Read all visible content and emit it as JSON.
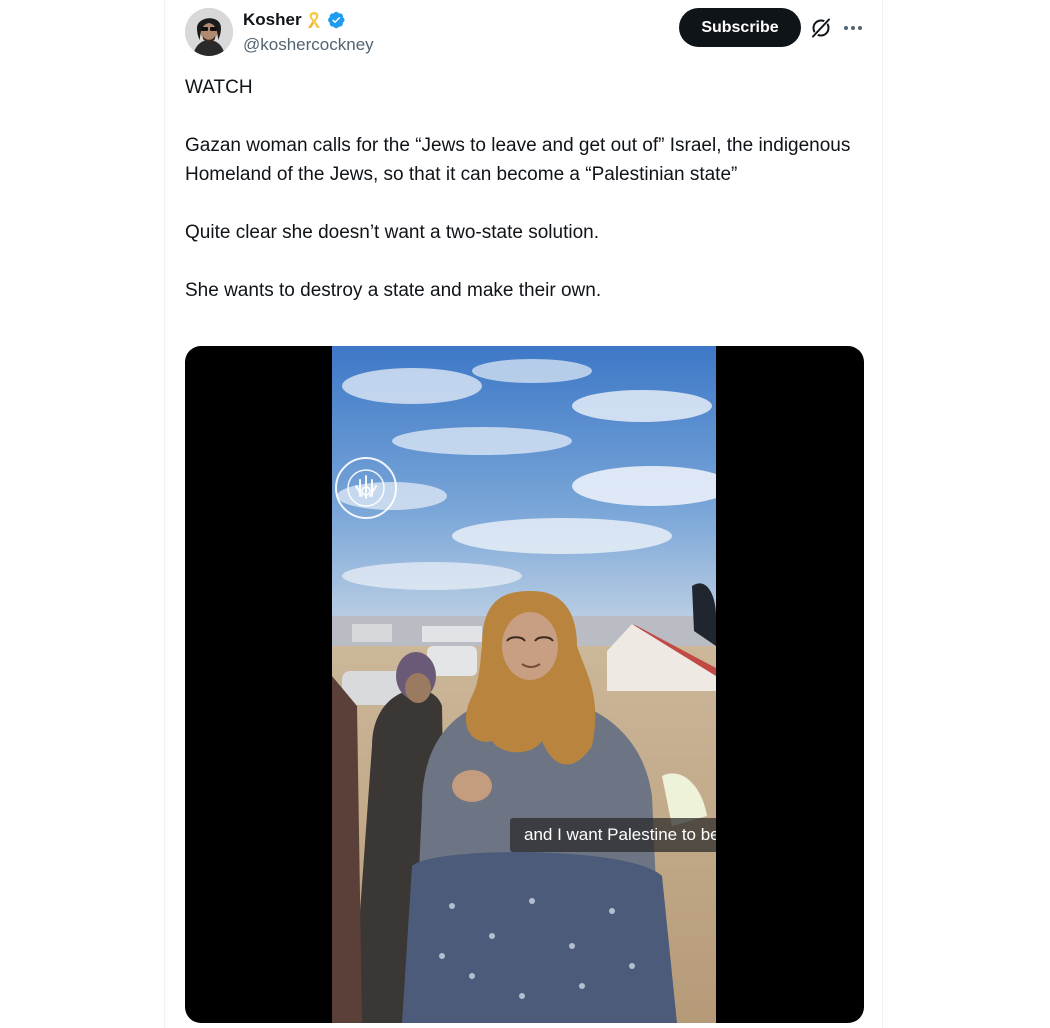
{
  "author": {
    "display_name": "Kosher",
    "handle": "@koshercockney",
    "ribbon_icon": "yellow-ribbon-icon",
    "verified_icon": "verified-badge-icon"
  },
  "header": {
    "subscribe_label": "Subscribe",
    "grok_icon": "grok-icon",
    "more_icon": "more-options-icon"
  },
  "tweet": {
    "paragraphs": [
      "WATCH",
      "Gazan woman calls for the “Jews to leave and get out of” Israel, the indigenous Homeland of the Jews, so that it can become a “Palestinian state”",
      "Quite clear she doesn’t want a two-state solution.",
      "She wants to destroy a state and make their own."
    ]
  },
  "media": {
    "caption": "and I want Palestine to be liberated from",
    "watermark_text": "FIVE LUCKY FINGERS"
  },
  "colors": {
    "text_primary": "#0f1419",
    "text_secondary": "#536471",
    "verified_blue": "#1d9bf0",
    "ribbon_yellow": "#f7c948"
  }
}
